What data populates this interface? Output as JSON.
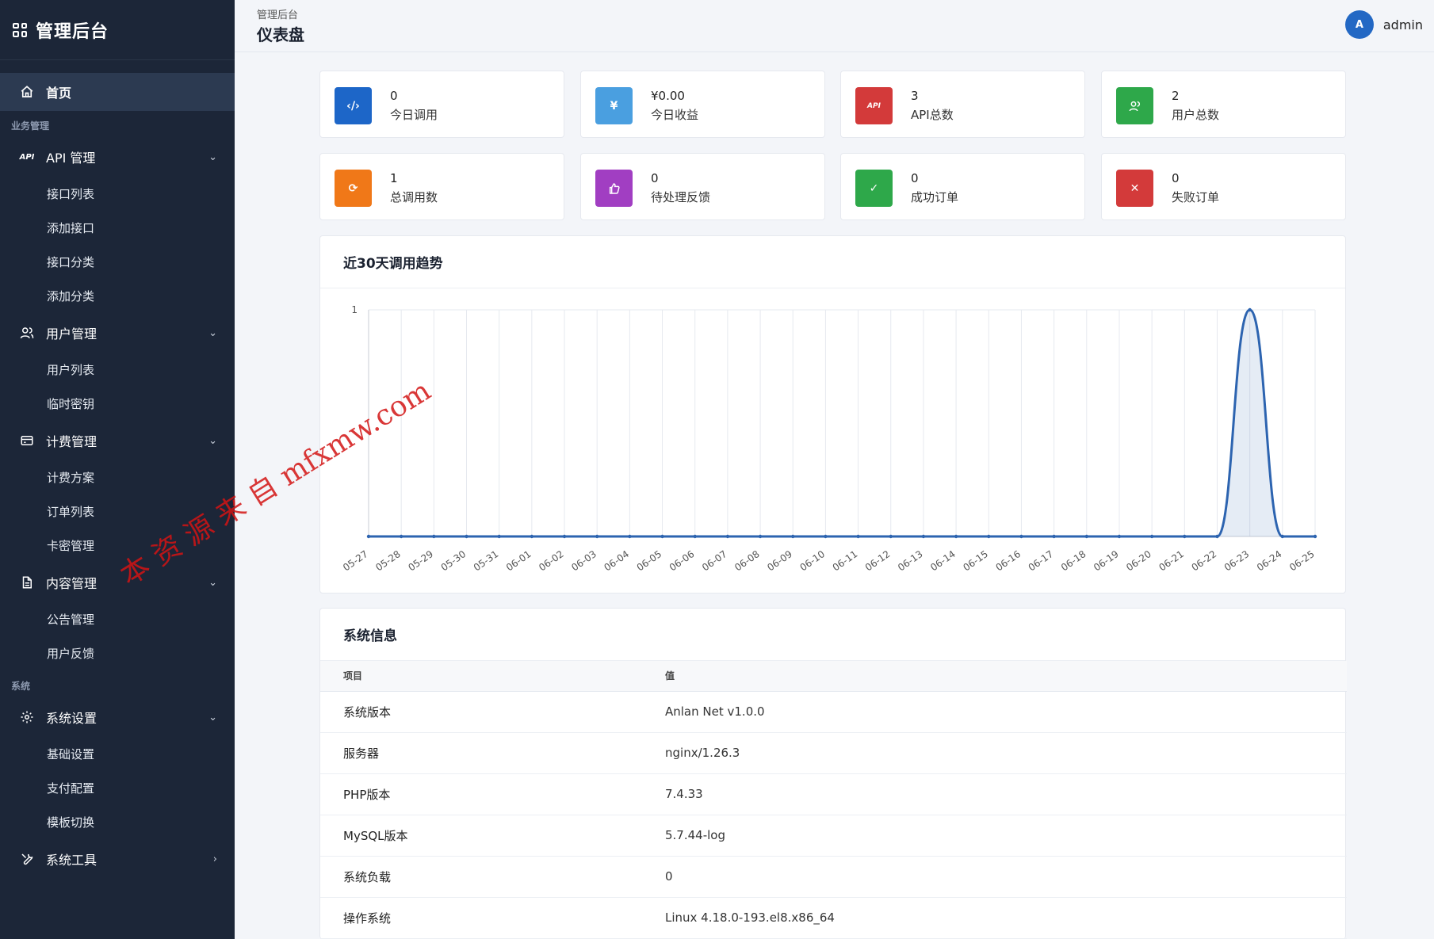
{
  "app": {
    "brand": "管理后台"
  },
  "header": {
    "breadcrumb": "管理后台",
    "page_title": "仪表盘",
    "user": {
      "avatar_letter": "A",
      "name": "admin"
    }
  },
  "sidebar": {
    "home": "首页",
    "section_business": "业务管理",
    "section_system": "系统",
    "api": {
      "tag": "API",
      "label": "API 管理",
      "items": [
        "接口列表",
        "添加接口",
        "接口分类",
        "添加分类"
      ]
    },
    "users": {
      "label": "用户管理",
      "items": [
        "用户列表",
        "临时密钥"
      ]
    },
    "billing": {
      "label": "计费管理",
      "items": [
        "计费方案",
        "订单列表",
        "卡密管理"
      ]
    },
    "content": {
      "label": "内容管理",
      "items": [
        "公告管理",
        "用户反馈"
      ]
    },
    "settings": {
      "label": "系统设置",
      "items": [
        "基础设置",
        "支付配置",
        "模板切换"
      ]
    },
    "tools": {
      "label": "系统工具"
    }
  },
  "stats": [
    {
      "value": "0",
      "label": "今日调用",
      "color": "#1d66c8",
      "icon": "code-icon"
    },
    {
      "value": "¥0.00",
      "label": "今日收益",
      "color": "#4a9fe0",
      "icon": "yen-icon"
    },
    {
      "value": "3",
      "label": "API总数",
      "color": "#d33a3a",
      "icon": "api-icon"
    },
    {
      "value": "2",
      "label": "用户总数",
      "color": "#2ea84a",
      "icon": "users-icon"
    },
    {
      "value": "1",
      "label": "总调用数",
      "color": "#f07818",
      "icon": "refresh-icon"
    },
    {
      "value": "0",
      "label": "待处理反馈",
      "color": "#a13ec2",
      "icon": "thumbs-up-icon"
    },
    {
      "value": "0",
      "label": "成功订单",
      "color": "#2ea84a",
      "icon": "check-icon"
    },
    {
      "value": "0",
      "label": "失败订单",
      "color": "#d33a3a",
      "icon": "close-icon"
    }
  ],
  "trend": {
    "title": "近30天调用趋势"
  },
  "chart_data": {
    "type": "line",
    "x": [
      "05-27",
      "05-28",
      "05-29",
      "05-30",
      "05-31",
      "06-01",
      "06-02",
      "06-03",
      "06-04",
      "06-05",
      "06-06",
      "06-07",
      "06-08",
      "06-09",
      "06-10",
      "06-11",
      "06-12",
      "06-13",
      "06-14",
      "06-15",
      "06-16",
      "06-17",
      "06-18",
      "06-19",
      "06-20",
      "06-21",
      "06-22",
      "06-23",
      "06-24",
      "06-25"
    ],
    "values": [
      0,
      0,
      0,
      0,
      0,
      0,
      0,
      0,
      0,
      0,
      0,
      0,
      0,
      0,
      0,
      0,
      0,
      0,
      0,
      0,
      0,
      0,
      0,
      0,
      0,
      0,
      0,
      1,
      0,
      0
    ],
    "ylim": [
      0,
      1
    ],
    "yticks": [
      1
    ],
    "grid": true,
    "line_color": "#2d64b0"
  },
  "sysinfo": {
    "title": "系统信息",
    "columns": [
      "项目",
      "值"
    ],
    "rows": [
      [
        "系统版本",
        "Anlan Net v1.0.0"
      ],
      [
        "服务器",
        "nginx/1.26.3"
      ],
      [
        "PHP版本",
        "7.4.33"
      ],
      [
        "MySQL版本",
        "5.7.44-log"
      ],
      [
        "系统负载",
        "0"
      ],
      [
        "操作系统",
        "Linux 4.18.0-193.el8.x86_64"
      ]
    ]
  },
  "watermark": "本 资 源 来 自 mfxmw.com"
}
